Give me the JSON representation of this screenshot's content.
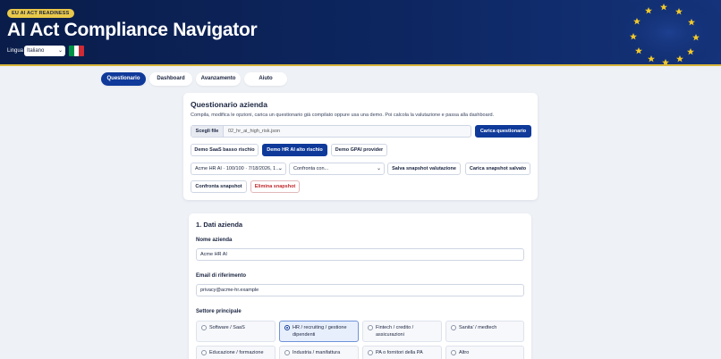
{
  "header": {
    "badge": "EU AI ACT READINESS",
    "title": "AI Act Compliance Navigator",
    "language_label": "Lingua",
    "language_value": "Italiano"
  },
  "tabs": [
    {
      "label": "Questionario",
      "active": true
    },
    {
      "label": "Dashboard",
      "active": false
    },
    {
      "label": "Avanzamento",
      "active": false
    },
    {
      "label": "Aiuto",
      "active": false
    }
  ],
  "questionnaire": {
    "title": "Questionario azienda",
    "description": "Compila, modifica le opzioni, carica un questionario già compilato oppure usa una demo. Poi calcola la valutazione e passa alla dashboard.",
    "file_button": "Scegli file",
    "file_name": "02_hr_ai_high_risk.json",
    "load_button": "Carica questionario",
    "demo_low": "Demo SaaS basso rischio",
    "demo_high": "Demo HR AI alto rischio",
    "demo_gpai": "Demo GPAI provider",
    "snapshot_select": "Acme HR AI · 100/100 · 7/18/2026, 1…",
    "compare_select": "Confronta con...",
    "save_snapshot": "Salva snapshot valutazione",
    "load_snapshot": "Carica snapshot salvato",
    "compare_snapshot": "Confronta snapshot",
    "delete_snapshot": "Elimina snapshot"
  },
  "company": {
    "section_title": "1. Dati azienda",
    "name_label": "Nome azienda",
    "name_value": "Acme HR AI",
    "email_label": "Email di riferimento",
    "email_value": "privacy@acme-hr.example",
    "sector_label": "Settore principale",
    "sectors": [
      {
        "label": "Software / SaaS",
        "selected": false
      },
      {
        "label": "HR / recruiting / gestione dipendenti",
        "selected": true
      },
      {
        "label": "Fintech / credito / assicurazioni",
        "selected": false
      },
      {
        "label": "Sanita' / medtech",
        "selected": false
      },
      {
        "label": "Educazione / formazione",
        "selected": false
      },
      {
        "label": "Industria / manifattura",
        "selected": false
      },
      {
        "label": "PA o fornitori della PA",
        "selected": false
      },
      {
        "label": "Altro",
        "selected": false
      }
    ]
  },
  "colors": {
    "accent": "#0f3a9a",
    "header": "#0d2660",
    "gold": "#e9c84a",
    "flag": [
      "#009246",
      "#ffffff",
      "#ce2b37"
    ],
    "danger": "#c0282d"
  }
}
